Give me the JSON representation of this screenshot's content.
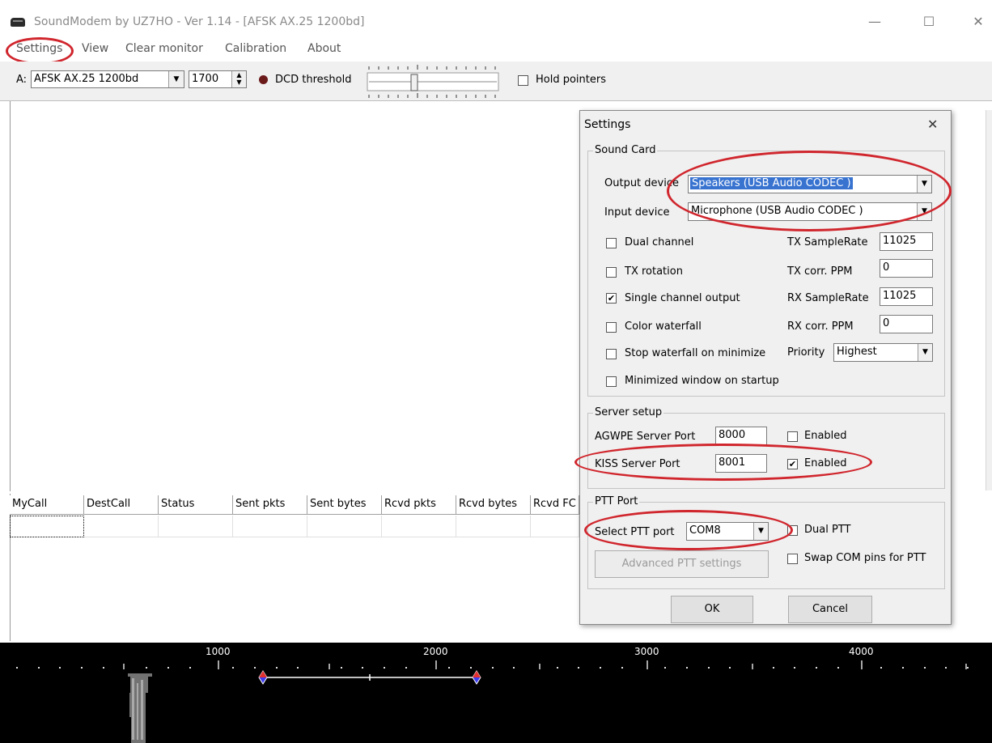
{
  "window": {
    "title": "SoundModem by UZ7HO - Ver 1.14 - [AFSK AX.25 1200bd]",
    "minimize": "—",
    "maximize": "☐",
    "close": "✕"
  },
  "menu": [
    "Settings",
    "View",
    "Clear monitor",
    "Calibration",
    "About"
  ],
  "toolbar": {
    "channel_label": "A:",
    "modem": "AFSK AX.25 1200bd",
    "frequency": "1700",
    "dcd_label": "DCD threshold",
    "hold_pointers": "Hold pointers",
    "hold_pointers_checked": false
  },
  "grid": {
    "columns": [
      "MyCall",
      "DestCall",
      "Status",
      "Sent pkts",
      "Sent bytes",
      "Rcvd pkts",
      "Rcvd bytes",
      "Rcvd FC"
    ]
  },
  "waterfall": {
    "freq_labels": [
      "1000",
      "2000",
      "3000",
      "4000"
    ]
  },
  "dialog": {
    "title": "Settings",
    "close": "✕",
    "sound_card": {
      "title": "Sound Card",
      "output_label": "Output device",
      "output_value": "Speakers (USB Audio CODEC )",
      "input_label": "Input device",
      "input_value": "Microphone (USB Audio CODEC )",
      "dual_channel": "Dual channel",
      "tx_rotation": "TX rotation",
      "single_channel": "Single channel output",
      "color_waterfall": "Color waterfall",
      "stop_waterfall": "Stop waterfall on minimize",
      "minimized_startup": "Minimized window on startup",
      "tx_samplerate_label": "TX SampleRate",
      "tx_samplerate": "11025",
      "tx_corr_label": "TX corr. PPM",
      "tx_corr": "0",
      "rx_samplerate_label": "RX SampleRate",
      "rx_samplerate": "11025",
      "rx_corr_label": "RX corr. PPM",
      "rx_corr": "0",
      "priority_label": "Priority",
      "priority": "Highest"
    },
    "server": {
      "title": "Server setup",
      "agwpe_label": "AGWPE Server Port",
      "agwpe_port": "8000",
      "agwpe_enabled": "Enabled",
      "kiss_label": "KISS Server Port",
      "kiss_port": "8001",
      "kiss_enabled": "Enabled"
    },
    "ptt": {
      "title": "PTT Port",
      "select_label": "Select PTT port",
      "port": "COM8",
      "dual_ptt": "Dual PTT",
      "swap_com": "Swap COM pins for PTT",
      "advanced": "Advanced PTT settings"
    },
    "ok": "OK",
    "cancel": "Cancel"
  },
  "colors": {
    "highlight": "#d0262d",
    "selection": "#3873d0"
  }
}
